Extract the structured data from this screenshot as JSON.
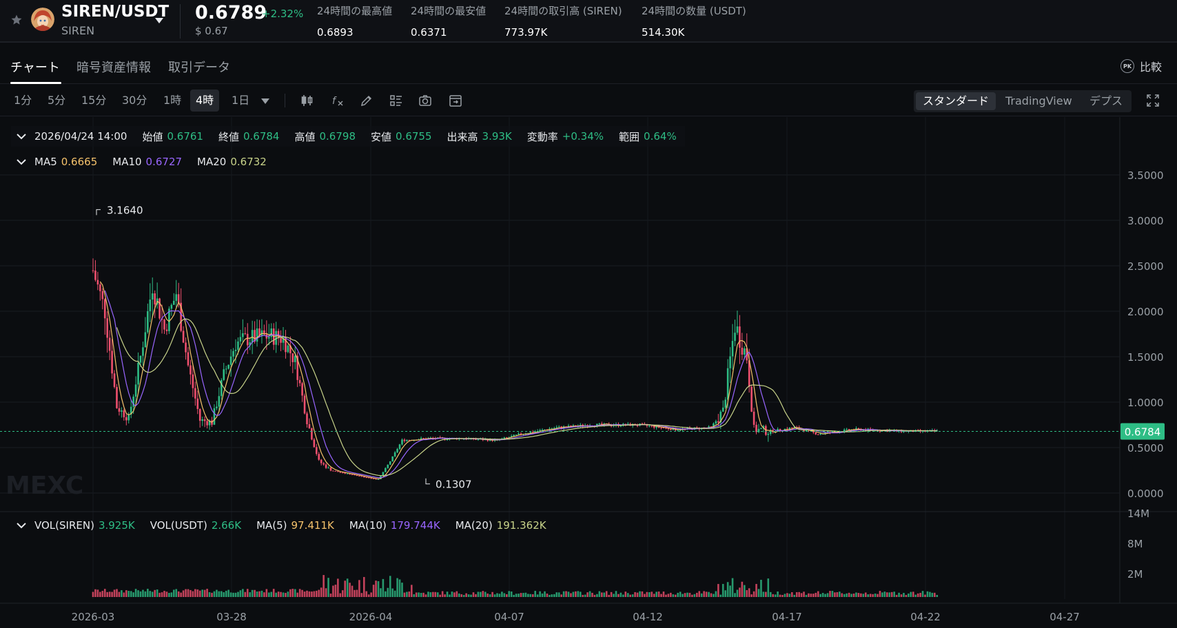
{
  "header": {
    "pair": "SIREN/USDT",
    "base": "SIREN",
    "price": "0.6789",
    "change": "+2.32%",
    "price_usd": "$ 0.67",
    "stats": [
      {
        "label": "24時間の最高値",
        "value": "0.6893"
      },
      {
        "label": "24時間の最安値",
        "value": "0.6371"
      },
      {
        "label": "24時間の取引高 (SIREN)",
        "value": "773.97K"
      },
      {
        "label": "24時間の数量 (USDT)",
        "value": "514.30K"
      }
    ]
  },
  "tabs": [
    {
      "label": "チャート",
      "active": true
    },
    {
      "label": "暗号資産情報",
      "active": false
    },
    {
      "label": "取引データ",
      "active": false
    }
  ],
  "compare": {
    "icon": "PK",
    "label": "比較"
  },
  "intervals": [
    {
      "label": "1分"
    },
    {
      "label": "5分"
    },
    {
      "label": "15分"
    },
    {
      "label": "30分"
    },
    {
      "label": "1時"
    },
    {
      "label": "4時",
      "active": true
    },
    {
      "label": "1日"
    }
  ],
  "toolbar_icons": [
    "candle-type-icon",
    "indicator-icon",
    "draw-icon",
    "settings-list-icon",
    "camera-icon",
    "calendar-icon"
  ],
  "views": [
    {
      "label": "スタンダード",
      "active": true
    },
    {
      "label": "TradingView"
    },
    {
      "label": "デプス"
    }
  ],
  "ohlc": {
    "datetime": "2026/04/24 14:00",
    "open_label": "始値",
    "open": "0.6761",
    "close_label": "終値",
    "close": "0.6784",
    "high_label": "高値",
    "high": "0.6798",
    "low_label": "安値",
    "low": "0.6755",
    "volume_label": "出来高",
    "volume": "3.93K",
    "change_label": "変動率",
    "change": "+0.34%",
    "range_label": "範囲",
    "range": "0.64%"
  },
  "ma": {
    "ma5_label": "MA5",
    "ma5": "0.6665",
    "ma10_label": "MA10",
    "ma10": "0.6727",
    "ma20_label": "MA20",
    "ma20": "0.6732"
  },
  "vol": {
    "siren_label": "VOL(SIREN)",
    "siren": "3.925K",
    "usdt_label": "VOL(USDT)",
    "usdt": "2.66K",
    "ma5_label": "MA(5)",
    "ma5": "97.411K",
    "ma10_label": "MA(10)",
    "ma10": "179.744K",
    "ma20_label": "MA(20)",
    "ma20": "191.362K"
  },
  "watermark": "MEXC",
  "colors": {
    "up": "#2ebd85",
    "down": "#f0506e",
    "ma5": "#f5c26b",
    "ma10": "#9966ff",
    "ma20": "#c8d38a"
  },
  "chart_data": {
    "type": "candlestick",
    "current_price_label": "0.6784",
    "high_label": "3.1640",
    "low_label": "0.1307",
    "y_ticks": [
      "3.5000",
      "3.0000",
      "2.5000",
      "2.0000",
      "1.5000",
      "1.0000",
      "0.5000",
      "0.0000"
    ],
    "vol_ticks": [
      "14M",
      "8M",
      "2M"
    ],
    "x_ticks": [
      "2026-03",
      "03-28",
      "2026-04",
      "04-07",
      "04-12",
      "04-17",
      "04-22",
      "04-27"
    ],
    "close_path": [
      [
        0,
        2.45
      ],
      [
        5,
        2.0
      ],
      [
        10,
        0.95
      ],
      [
        15,
        0.82
      ],
      [
        20,
        1.5
      ],
      [
        25,
        2.3
      ],
      [
        30,
        1.8
      ],
      [
        35,
        2.2
      ],
      [
        40,
        1.4
      ],
      [
        45,
        0.8
      ],
      [
        50,
        0.78
      ],
      [
        55,
        1.3
      ],
      [
        60,
        1.65
      ],
      [
        65,
        1.7
      ],
      [
        70,
        1.72
      ],
      [
        75,
        1.73
      ],
      [
        80,
        1.7
      ],
      [
        85,
        1.45
      ],
      [
        90,
        0.8
      ],
      [
        95,
        0.35
      ],
      [
        100,
        0.25
      ],
      [
        105,
        0.22
      ],
      [
        110,
        0.2
      ],
      [
        115,
        0.17
      ],
      [
        120,
        0.15
      ],
      [
        125,
        0.35
      ],
      [
        130,
        0.58
      ],
      [
        140,
        0.6
      ],
      [
        155,
        0.6
      ],
      [
        170,
        0.58
      ],
      [
        180,
        0.65
      ],
      [
        195,
        0.72
      ],
      [
        210,
        0.75
      ],
      [
        230,
        0.75
      ],
      [
        245,
        0.7
      ],
      [
        260,
        0.72
      ],
      [
        265,
        0.9
      ],
      [
        270,
        1.85
      ],
      [
        275,
        1.5
      ],
      [
        278,
        0.7
      ],
      [
        285,
        0.68
      ],
      [
        295,
        0.72
      ],
      [
        305,
        0.65
      ],
      [
        320,
        0.7
      ],
      [
        340,
        0.68
      ],
      [
        355,
        0.68
      ]
    ]
  }
}
